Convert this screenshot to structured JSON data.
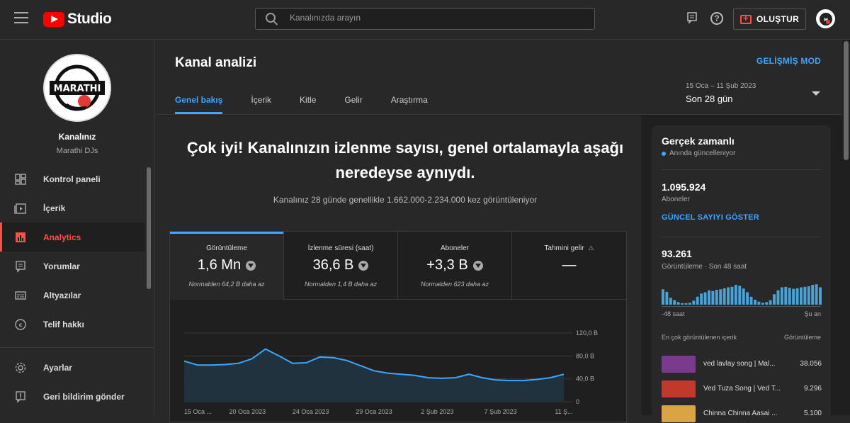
{
  "header": {
    "logo_text": "Studio",
    "search_placeholder": "Kanalınızda arayın",
    "create_label": "OLUŞTUR",
    "icons": [
      "menu-icon",
      "youtube-logo-icon",
      "search-icon",
      "feedback-icon",
      "help-icon",
      "create-video-icon",
      "account-avatar"
    ]
  },
  "sidebar": {
    "channel_label": "Kanalınız",
    "channel_name": "Marathi DJs",
    "avatar_text": "MARATHI",
    "items": [
      {
        "label": "Kontrol paneli",
        "icon": "dashboard-icon"
      },
      {
        "label": "İçerik",
        "icon": "content-icon"
      },
      {
        "label": "Analytics",
        "icon": "analytics-icon",
        "active": true
      },
      {
        "label": "Yorumlar",
        "icon": "comments-icon"
      },
      {
        "label": "Altyazılar",
        "icon": "subtitles-icon"
      },
      {
        "label": "Telif hakkı",
        "icon": "copyright-icon"
      }
    ],
    "bottom_items": [
      {
        "label": "Ayarlar",
        "icon": "settings-icon"
      },
      {
        "label": "Geri bildirim gönder",
        "icon": "feedback-icon"
      }
    ]
  },
  "page": {
    "title": "Kanal analizi",
    "advanced_mode": "GELİŞMİŞ MOD",
    "tabs": [
      "Genel bakış",
      "İçerik",
      "Kitle",
      "Gelir",
      "Araştırma"
    ],
    "active_tab": "Genel bakış",
    "date_range": "15 Oca – 11 Şub 2023",
    "date_label": "Son 28 gün"
  },
  "overview": {
    "headline": "Çok iyi! Kanalınızın izlenme sayısı, genel ortalamayla aşağı neredeyse aynıydı.",
    "subline": "Kanalınız 28 günde genellikle 1.662.000-2.234.000 kez görüntüleniyor",
    "metrics": [
      {
        "label": "Görüntüleme",
        "value": "1,6 Mn",
        "note": "Normalden 64,2 B daha az",
        "selected": true
      },
      {
        "label": "İzlenme süresi (saat)",
        "value": "36,6 B",
        "note": "Normalden 1,4 B daha az"
      },
      {
        "label": "Aboneler",
        "value": "+3,3 B",
        "note": "Normalden 623 daha az"
      },
      {
        "label": "Tahmini gelir",
        "value": "—",
        "note": "",
        "icon": "warning-icon"
      }
    ]
  },
  "chart_data": {
    "type": "area",
    "x": [
      "15 Oca ...",
      "20 Oca 2023",
      "24 Oca 2023",
      "29 Oca 2023",
      "2 Şub 2023",
      "7 Şub 2023",
      "11 Ş..."
    ],
    "y_ticks": [
      "120,0 B",
      "80,0 B",
      "40,0 B",
      "0"
    ],
    "ylim": [
      0,
      120000
    ],
    "color": "#3ea6ff",
    "values": [
      71000,
      64000,
      64000,
      65000,
      67000,
      75000,
      92000,
      80000,
      67000,
      68000,
      78000,
      77000,
      72000,
      63000,
      54000,
      50000,
      48000,
      46000,
      42000,
      41000,
      42000,
      48000,
      42000,
      38000,
      37000,
      37000,
      39000,
      42000,
      48000
    ]
  },
  "realtime": {
    "title": "Gerçek zamanlı",
    "live_label": "Anında güncelleniyor",
    "subscribers_value": "1.095.924",
    "subscribers_label": "Aboneler",
    "show_count_label": "GÜNCEL SAYIYI GÖSTER",
    "views_value": "93.261",
    "views_label": "Görüntüleme · Son 48 saat",
    "bar_values": [
      0.62,
      0.52,
      0.28,
      0.18,
      0.1,
      0.06,
      0.06,
      0.08,
      0.16,
      0.32,
      0.45,
      0.5,
      0.58,
      0.55,
      0.6,
      0.62,
      0.66,
      0.7,
      0.72,
      0.8,
      0.76,
      0.65,
      0.5,
      0.32,
      0.2,
      0.12,
      0.08,
      0.1,
      0.18,
      0.42,
      0.58,
      0.7,
      0.72,
      0.68,
      0.64,
      0.66,
      0.7,
      0.72,
      0.74,
      0.8,
      0.82,
      0.7
    ],
    "bar_axis_left": "-48 saat",
    "bar_axis_right": "Şu an",
    "top_content_label": "En çok görüntülenen içerik",
    "top_content_metric": "Görüntüleme",
    "top_items": [
      {
        "title": "ved lavlay song | Mal...",
        "value": "38.056",
        "thumb_color": "#7a3b8f"
      },
      {
        "title": "Ved Tuza Song | Ved T...",
        "value": "9.296",
        "thumb_color": "#c0392b"
      },
      {
        "title": "Chinna Chinna Aasai ...",
        "value": "5.100",
        "thumb_color": "#d9a441"
      }
    ]
  }
}
